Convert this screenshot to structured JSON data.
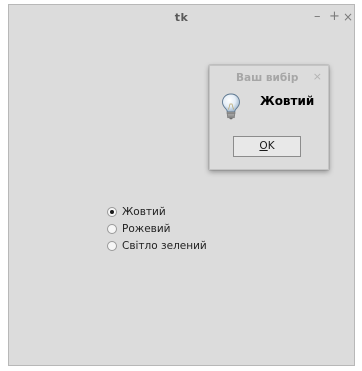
{
  "window": {
    "title": "tk",
    "minimize_glyph": "–",
    "maximize_glyph": "+",
    "close_glyph": "×"
  },
  "radio_group": {
    "selected_index": 0,
    "options": [
      {
        "label": "Жовтий",
        "checked": true
      },
      {
        "label": "Рожевий",
        "checked": false
      },
      {
        "label": "Світло зелений",
        "checked": false
      }
    ]
  },
  "dialog": {
    "title": "Ваш вибір",
    "close_glyph": "×",
    "icon": "lightbulb-icon",
    "message": "Жовтий",
    "ok_button": {
      "mnemonic": "O",
      "rest": "K"
    }
  },
  "colors": {
    "window_bg": "#dcdcdc",
    "title_text": "#5a5a5a",
    "dialog_title_text": "#a6a6a6"
  }
}
